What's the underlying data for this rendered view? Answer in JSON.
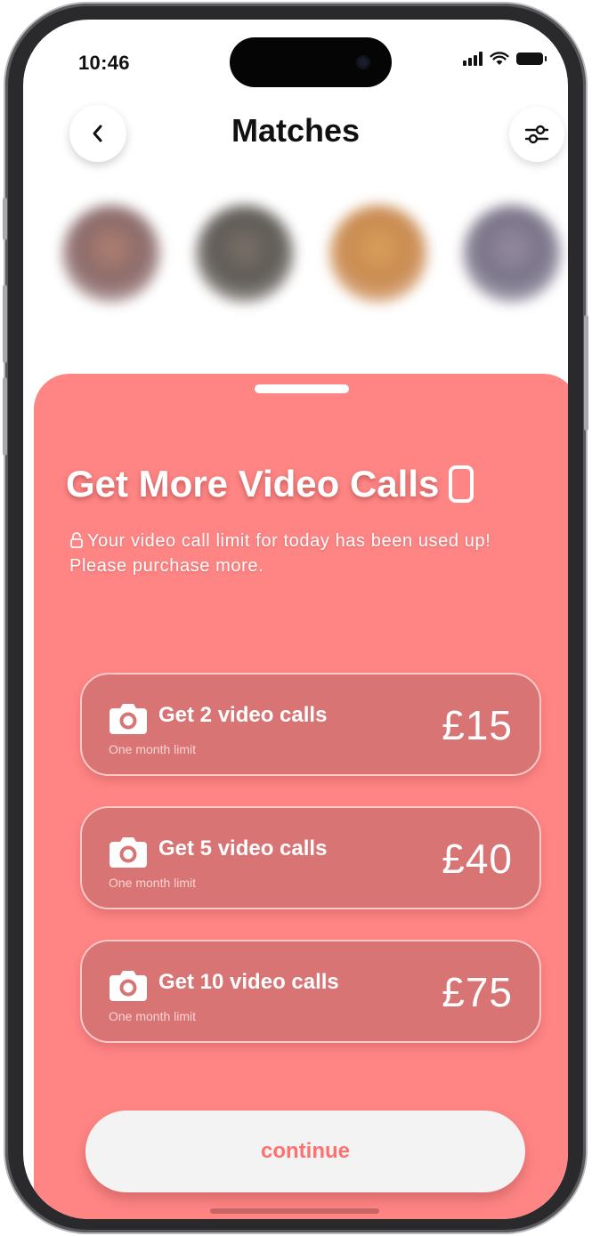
{
  "status_bar": {
    "time": "10:46"
  },
  "header": {
    "title": "Matches"
  },
  "avatars": [
    {
      "color": "#8a6a6a"
    },
    {
      "color": "#5e5a56"
    },
    {
      "color": "#c98a50"
    },
    {
      "color": "#7a7488"
    }
  ],
  "sheet": {
    "background": "#ff8585",
    "title": "Get More Video Calls",
    "description": "Your video call limit for today has been used up! Please purchase more.",
    "options": [
      {
        "label": "Get 2 video calls",
        "subtitle": "One month limit",
        "price": "£15"
      },
      {
        "label": "Get 5 video calls",
        "subtitle": "One month limit",
        "price": "£40"
      },
      {
        "label": "Get 10 video calls",
        "subtitle": "One month limit",
        "price": "£75"
      }
    ],
    "continue_label": "continue"
  },
  "icons": {
    "back": "chevron-left-icon",
    "filter": "sliders-icon",
    "title_icon": "smartphone-icon",
    "lock": "lock-icon",
    "option": "camera-icon"
  }
}
